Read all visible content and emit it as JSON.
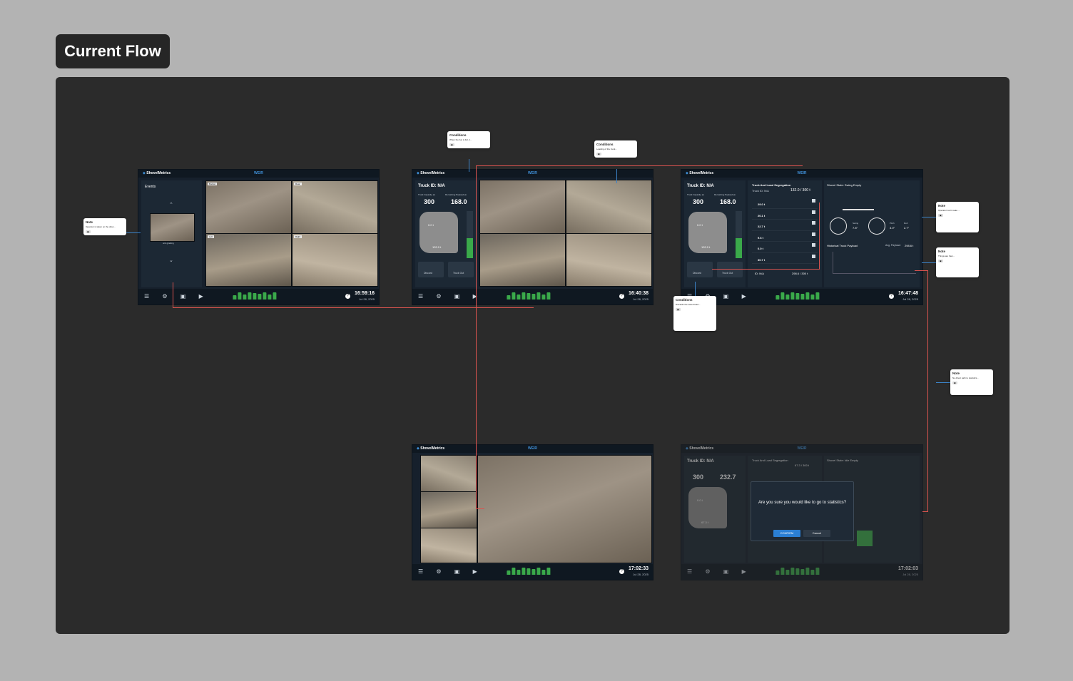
{
  "board": {
    "title": "Current Flow"
  },
  "screen_events": {
    "logo": "ShovelMetrics",
    "brand": "WEIR",
    "panel_title": "Events",
    "thumb_caption": "unit grading",
    "time": "16:59:16",
    "date": "Jul 28, 2025",
    "bars": [
      6,
      10,
      7,
      10,
      9,
      8,
      10,
      7,
      10
    ]
  },
  "screen_truck_a": {
    "logo": "ShovelMetrics",
    "brand": "WEIR",
    "truck_id": "Truck ID: N/A",
    "capacity_label": "Truck Capacity (t)",
    "capacity": "300",
    "remaining_label": "Remaining Payload (t)",
    "remaining": "168.0",
    "bucket_value": "0.0 t",
    "load_value": "132.0 t",
    "discard": "Discard",
    "truck_out": "Truck Out",
    "time": "16:40:38",
    "date": "Jul 28, 2025",
    "bars": [
      6,
      10,
      7,
      10,
      9,
      8,
      10,
      7,
      10
    ]
  },
  "screen_truck_b": {
    "logo": "ShovelMetrics",
    "brand": "WEIR",
    "truck_id": "Truck ID: N/A",
    "capacity_label": "Truck Capacity (t)",
    "capacity": "300",
    "remaining_label": "Remaining Payload (t)",
    "remaining": "168.0",
    "bucket_value": "0.0 t",
    "load_value": "132.0 t",
    "discard": "Discard",
    "truck_out": "Truck Out",
    "segregation_title": "Truck And Load Segregation",
    "segregation_truck": "Truck ID: N/A",
    "segregation_total": "132.0 / 300 t",
    "loads": [
      "29.0 t",
      "20.1 t",
      "22.7 t",
      "9.6 t",
      "0.0 t",
      "30.7 t"
    ],
    "footer_id": "ID: N/A",
    "footer_total": "298.6 / 300 t",
    "shovel_state": "Shovel State: Swing Empty",
    "swing": "Swing",
    "swing_val": "7.8°",
    "pitch": "Pitch",
    "pitch_val": "3.0°",
    "roll": "Roll",
    "roll_val": "2.7°",
    "hist_title": "Historical Truck Payload",
    "avg_label": "Avg. Payload:",
    "avg_val": "298.6 t",
    "time": "16:47:48",
    "date": "Jul 28, 2025",
    "bars": [
      6,
      10,
      7,
      10,
      9,
      8,
      10,
      7,
      10
    ]
  },
  "screen_camera": {
    "logo": "ShovelMetrics",
    "brand": "WEIR",
    "time": "17:02:33",
    "date": "Jul 28, 2025",
    "bars": [
      6,
      10,
      7,
      10,
      9,
      8,
      10,
      7,
      10
    ]
  },
  "screen_modal": {
    "logo": "ShovelMetrics",
    "brand": "WEIR",
    "truck_id": "Truck ID: N/A",
    "capacity": "300",
    "remaining": "232.7",
    "bucket_value": "0.0 t",
    "load_value": "67.3 t",
    "segregation_title": "Truck And Load Segregation",
    "segregation_total": "67.3 / 300 t",
    "shovel_state": "Shovel State: Idle Empty",
    "modal_question": "Are you sure you would like to go to statistics?",
    "confirm": "CONFIRM",
    "cancel": "Cancel",
    "time": "17:02:03",
    "date": "Jul 28, 2025",
    "bars": [
      6,
      10,
      7,
      10,
      9,
      8,
      10,
      7,
      10
    ]
  },
  "notes": [
    {
      "title": "Note",
      "body": "Operator is taken on the direc..."
    },
    {
      "title": "Conditions",
      "body": "When the bar is full, it..."
    },
    {
      "title": "Conditions",
      "body": "Loading of the truck..."
    },
    {
      "title": "Conditions",
      "body": "Discards the saved load..."
    },
    {
      "title": "Note",
      "body": "Operator can't make ..."
    },
    {
      "title": "Note",
      "body": "Things are then..."
    },
    {
      "title": "Note",
      "body": "No direct path to statistics..."
    }
  ]
}
